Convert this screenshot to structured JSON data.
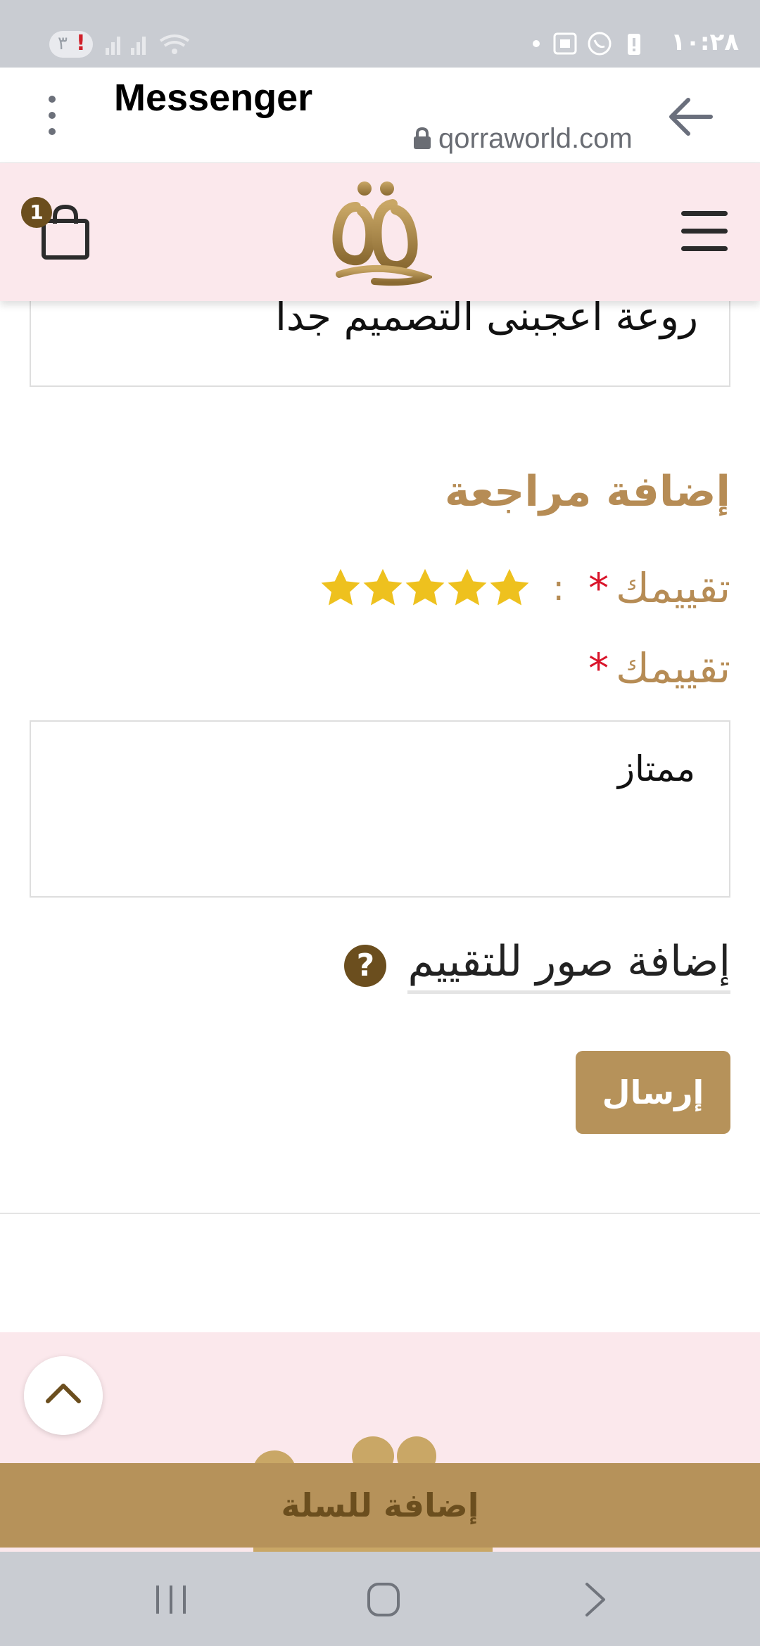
{
  "status_bar": {
    "time": "١٠:٢٨",
    "pill_text": "٣",
    "pill_alert": "!"
  },
  "browser": {
    "title": "Messenger",
    "url": "qorraworld.com"
  },
  "site_header": {
    "cart_count": "1"
  },
  "previous_review": {
    "text": "روعة اعجبنى التصميم جدا"
  },
  "review_form": {
    "section_title": "إضافة مراجعة",
    "rating_label": "تقييمك",
    "rating_required_mark": "*",
    "rating_colon": ":",
    "rating_value": 5,
    "rating_max": 5,
    "review_label": "تقييمك",
    "review_required_mark": "*",
    "review_text": "ممتاز",
    "add_photos_label": "إضافة صور للتقييم",
    "help_glyph": "?",
    "submit_label": "إرسال"
  },
  "footer": {
    "add_to_cart_label": "إضافة للسلة"
  },
  "colors": {
    "gold": "#b6925a",
    "gold_text": "#b68c55",
    "pink_bg": "#fbe8ec",
    "star": "#eec11e",
    "required": "#d9142a",
    "dark_brown": "#6b4e1e"
  },
  "icons": {
    "back": "arrow-left-icon",
    "lock": "lock-icon",
    "kebab": "more-vertical-icon",
    "cart": "shopping-bag-icon",
    "menu": "hamburger-menu-icon",
    "help": "help-circle-icon",
    "scroll_top": "chevron-up-icon",
    "star": "star-icon"
  }
}
